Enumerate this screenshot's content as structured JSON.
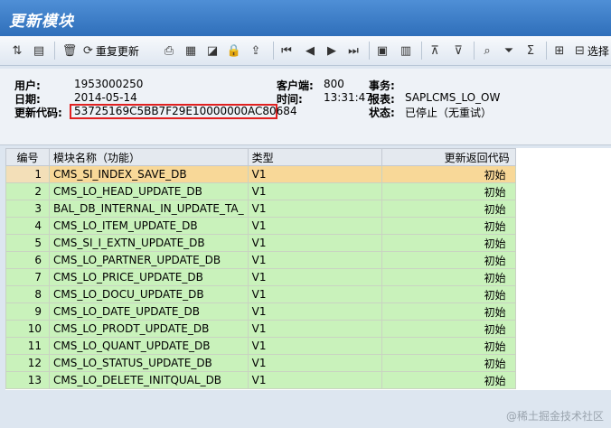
{
  "window": {
    "title": "更新模块"
  },
  "toolbar": {
    "reupdate_label": "重复更新",
    "select_label": "选择"
  },
  "header": {
    "user_label": "用户:",
    "user_value": "1953000250",
    "date_label": "日期:",
    "date_value": "2014-05-14",
    "code_label": "更新代码:",
    "code_value": "53725169C5BB7F29E10000000AC80684",
    "client_label": "客户端:",
    "client_value": "800",
    "time_label": "时间:",
    "time_value": "13:31:47",
    "txn_label": "事务:",
    "txn_value": "",
    "report_label": "报表:",
    "report_value": "SAPLCMS_LO_OW",
    "status_label": "状态:",
    "status_value": "已停止（无重试）"
  },
  "table": {
    "columns": [
      "编号",
      "模块名称（功能）",
      "类型",
      "更新返回代码"
    ],
    "rows": [
      {
        "no": "1",
        "name": "CMS_SI_INDEX_SAVE_DB",
        "type": "V1",
        "code": "初始"
      },
      {
        "no": "2",
        "name": "CMS_LO_HEAD_UPDATE_DB",
        "type": "V1",
        "code": "初始"
      },
      {
        "no": "3",
        "name": "BAL_DB_INTERNAL_IN_UPDATE_TA_",
        "type": "V1",
        "code": "初始"
      },
      {
        "no": "4",
        "name": "CMS_LO_ITEM_UPDATE_DB",
        "type": "V1",
        "code": "初始"
      },
      {
        "no": "5",
        "name": "CMS_SI_I_EXTN_UPDATE_DB",
        "type": "V1",
        "code": "初始"
      },
      {
        "no": "6",
        "name": "CMS_LO_PARTNER_UPDATE_DB",
        "type": "V1",
        "code": "初始"
      },
      {
        "no": "7",
        "name": "CMS_LO_PRICE_UPDATE_DB",
        "type": "V1",
        "code": "初始"
      },
      {
        "no": "8",
        "name": "CMS_LO_DOCU_UPDATE_DB",
        "type": "V1",
        "code": "初始"
      },
      {
        "no": "9",
        "name": "CMS_LO_DATE_UPDATE_DB",
        "type": "V1",
        "code": "初始"
      },
      {
        "no": "10",
        "name": "CMS_LO_PRODT_UPDATE_DB",
        "type": "V1",
        "code": "初始"
      },
      {
        "no": "11",
        "name": "CMS_LO_QUANT_UPDATE_DB",
        "type": "V1",
        "code": "初始"
      },
      {
        "no": "12",
        "name": "CMS_LO_STATUS_UPDATE_DB",
        "type": "V1",
        "code": "初始"
      },
      {
        "no": "13",
        "name": "CMS_LO_DELETE_INITQUAL_DB",
        "type": "V1",
        "code": "初始"
      }
    ]
  },
  "watermark": "@稀土掘金技术社区",
  "colors": {
    "title_bar": "#2f6fba",
    "row_green": "#c9f2bb",
    "row_selected": "#f8d898",
    "highlight_box": "#e02020"
  },
  "icons": {
    "toolbar": [
      "details-icon",
      "display-icon",
      "delete-icon",
      "repeat-update-icon",
      "printer-icon",
      "list-icon",
      "graphic-icon",
      "lock-icon",
      "export-icon",
      "first-page-icon",
      "previous-page-icon",
      "next-page-icon",
      "last-page-icon",
      "layout-icon",
      "document-icon",
      "sort-ascending-icon",
      "sort-descending-icon",
      "find-icon",
      "filter-icon",
      "sum-icon",
      "select-all-icon",
      "deselect-icon"
    ]
  }
}
